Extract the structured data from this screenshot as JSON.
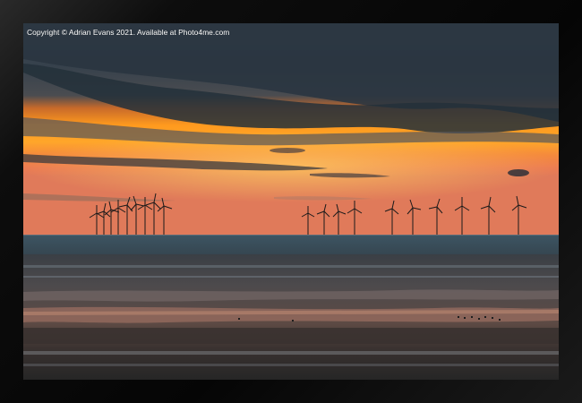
{
  "photo": {
    "copyright_text": "Copyright © Adrian Evans 2021. Available at Photo4me.com",
    "subject": "offshore-wind-farm-sunset",
    "frame_color": "#0b0b0b",
    "colors": {
      "sky_top": "#3c4650",
      "sky_cloud": "#2b3640",
      "sunset_orange": "#ff8a1a",
      "sunset_yellow": "#ffb42a",
      "horizon_pink": "#f07a4a",
      "sea": "#3f5563",
      "sand_dark": "#2c2a28",
      "sand_wet": "#6b5a52"
    }
  }
}
